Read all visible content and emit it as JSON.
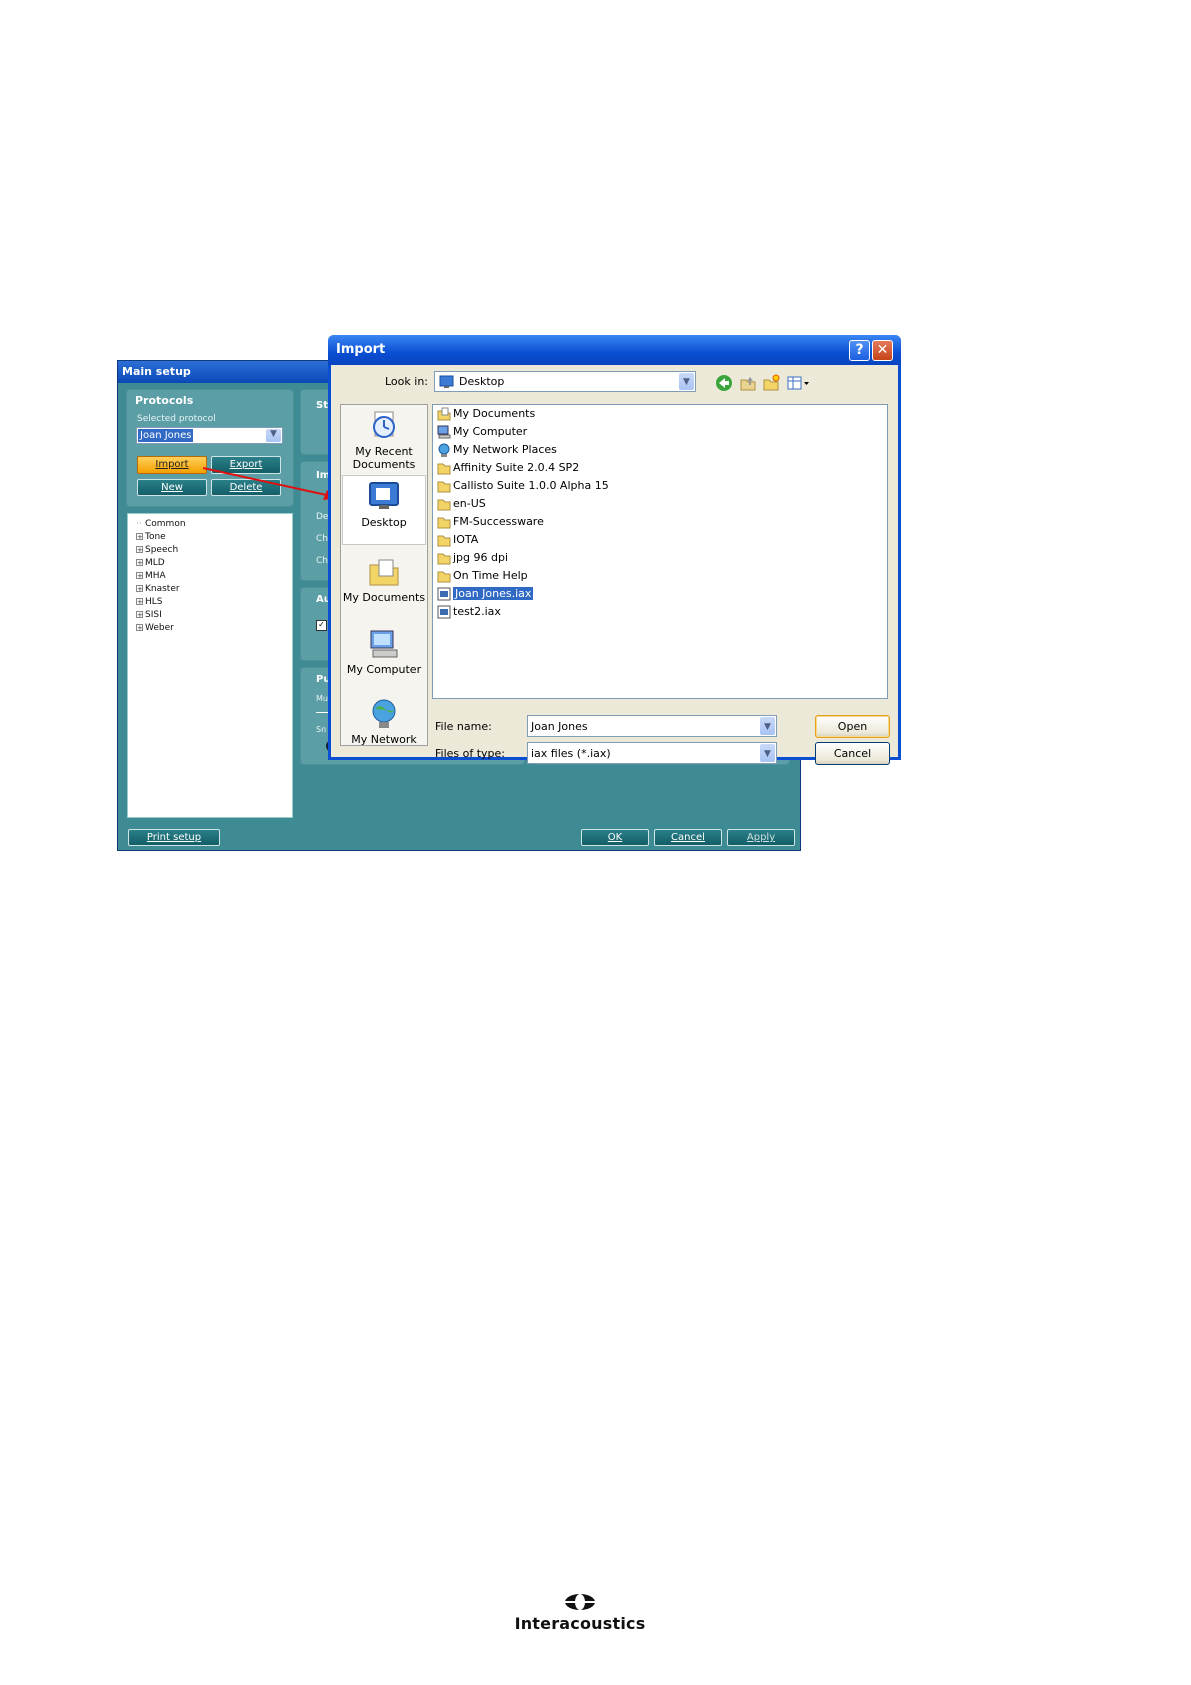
{
  "main_setup": {
    "title": "Main setup",
    "protocols": {
      "title": "Protocols",
      "selected_label": "Selected protocol",
      "selected_value": "Joan Jones",
      "import_label": "Import",
      "export_label": "Export",
      "new_label": "New",
      "delete_label": "Delete"
    },
    "tree": [
      "Common",
      "Tone",
      "Speech",
      "MLD",
      "MHA",
      "Knaster",
      "HLS",
      "SISI",
      "Weber"
    ],
    "partial_labels": {
      "st": "St",
      "im": "Im",
      "de": "De",
      "ch1": "Ch",
      "ch2": "Ch",
      "au": "Au",
      "pu": "Pu",
      "mu": "Mu",
      "sn": "Sn"
    },
    "print_setup_label": "Print setup",
    "ok_label": "OK",
    "cancel_label": "Cancel",
    "apply_label": "Apply"
  },
  "import_dialog": {
    "title": "Import",
    "help_glyph": "?",
    "close_glyph": "✕",
    "look_in_label": "Look in:",
    "look_in_value": "Desktop",
    "places": [
      "My Recent Documents",
      "Desktop",
      "My Documents",
      "My Computer",
      "My Network"
    ],
    "files": [
      {
        "name": "My Documents",
        "icon": "my-documents-icon"
      },
      {
        "name": "My Computer",
        "icon": "computer-icon"
      },
      {
        "name": "My Network Places",
        "icon": "network-icon"
      },
      {
        "name": "Affinity Suite 2.0.4 SP2",
        "icon": "folder-icon"
      },
      {
        "name": "Callisto Suite 1.0.0 Alpha 15",
        "icon": "folder-icon"
      },
      {
        "name": "en-US",
        "icon": "folder-icon"
      },
      {
        "name": "FM-Successware",
        "icon": "folder-icon"
      },
      {
        "name": "IOTA",
        "icon": "folder-icon"
      },
      {
        "name": "jpg 96 dpi",
        "icon": "folder-icon"
      },
      {
        "name": "On Time Help",
        "icon": "folder-icon"
      },
      {
        "name": "Joan Jones.iax",
        "icon": "iax-file-icon",
        "selected": true
      },
      {
        "name": "test2.iax",
        "icon": "iax-file-icon"
      }
    ],
    "file_name_label": "File name:",
    "file_name_value": "Joan Jones",
    "files_of_type_label": "Files of type:",
    "files_of_type_value": "iax files (*.iax)",
    "open_label": "Open",
    "cancel_label": "Cancel"
  },
  "footer": {
    "brand": "Interacoustics"
  }
}
